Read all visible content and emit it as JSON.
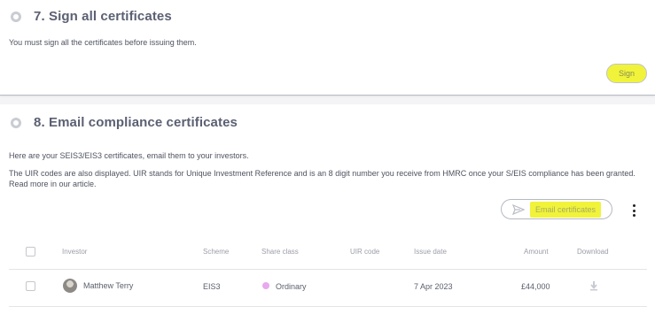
{
  "step7": {
    "title": "7. Sign all certificates",
    "description": "You must sign all the certificates before issuing them.",
    "sign_label": "Sign"
  },
  "step8": {
    "title": "8. Email compliance certificates",
    "intro": "Here are your SEIS3/EIS3 certificates, email them to your investors.",
    "uir_note": "The UIR codes are also displayed. UIR stands for Unique Investment Reference and is an 8 digit number you receive from HMRC once your S/EIS compliance has been granted. Read more in our article.",
    "email_label": "Email certificates"
  },
  "table": {
    "columns": {
      "investor": "Investor",
      "scheme": "Scheme",
      "share_class": "Share class",
      "uir_code": "UIR code",
      "issue_date": "Issue date",
      "amount": "Amount",
      "download": "Download"
    },
    "rows": [
      {
        "investor": "Matthew Terry",
        "scheme": "EIS3",
        "share_class": "Ordinary",
        "uir_code": "",
        "issue_date": "7 Apr 2023",
        "amount": "£44,000"
      }
    ]
  },
  "icons": {
    "step_marker": "radio-circle-icon",
    "email": "send-icon",
    "menu": "kebab-menu-icon",
    "download": "download-icon",
    "share_class_dot": "pink-dot"
  },
  "colors": {
    "highlight": "#f0f33a",
    "share_class_dot": "#e8a8ee",
    "title": "#5b6072"
  }
}
